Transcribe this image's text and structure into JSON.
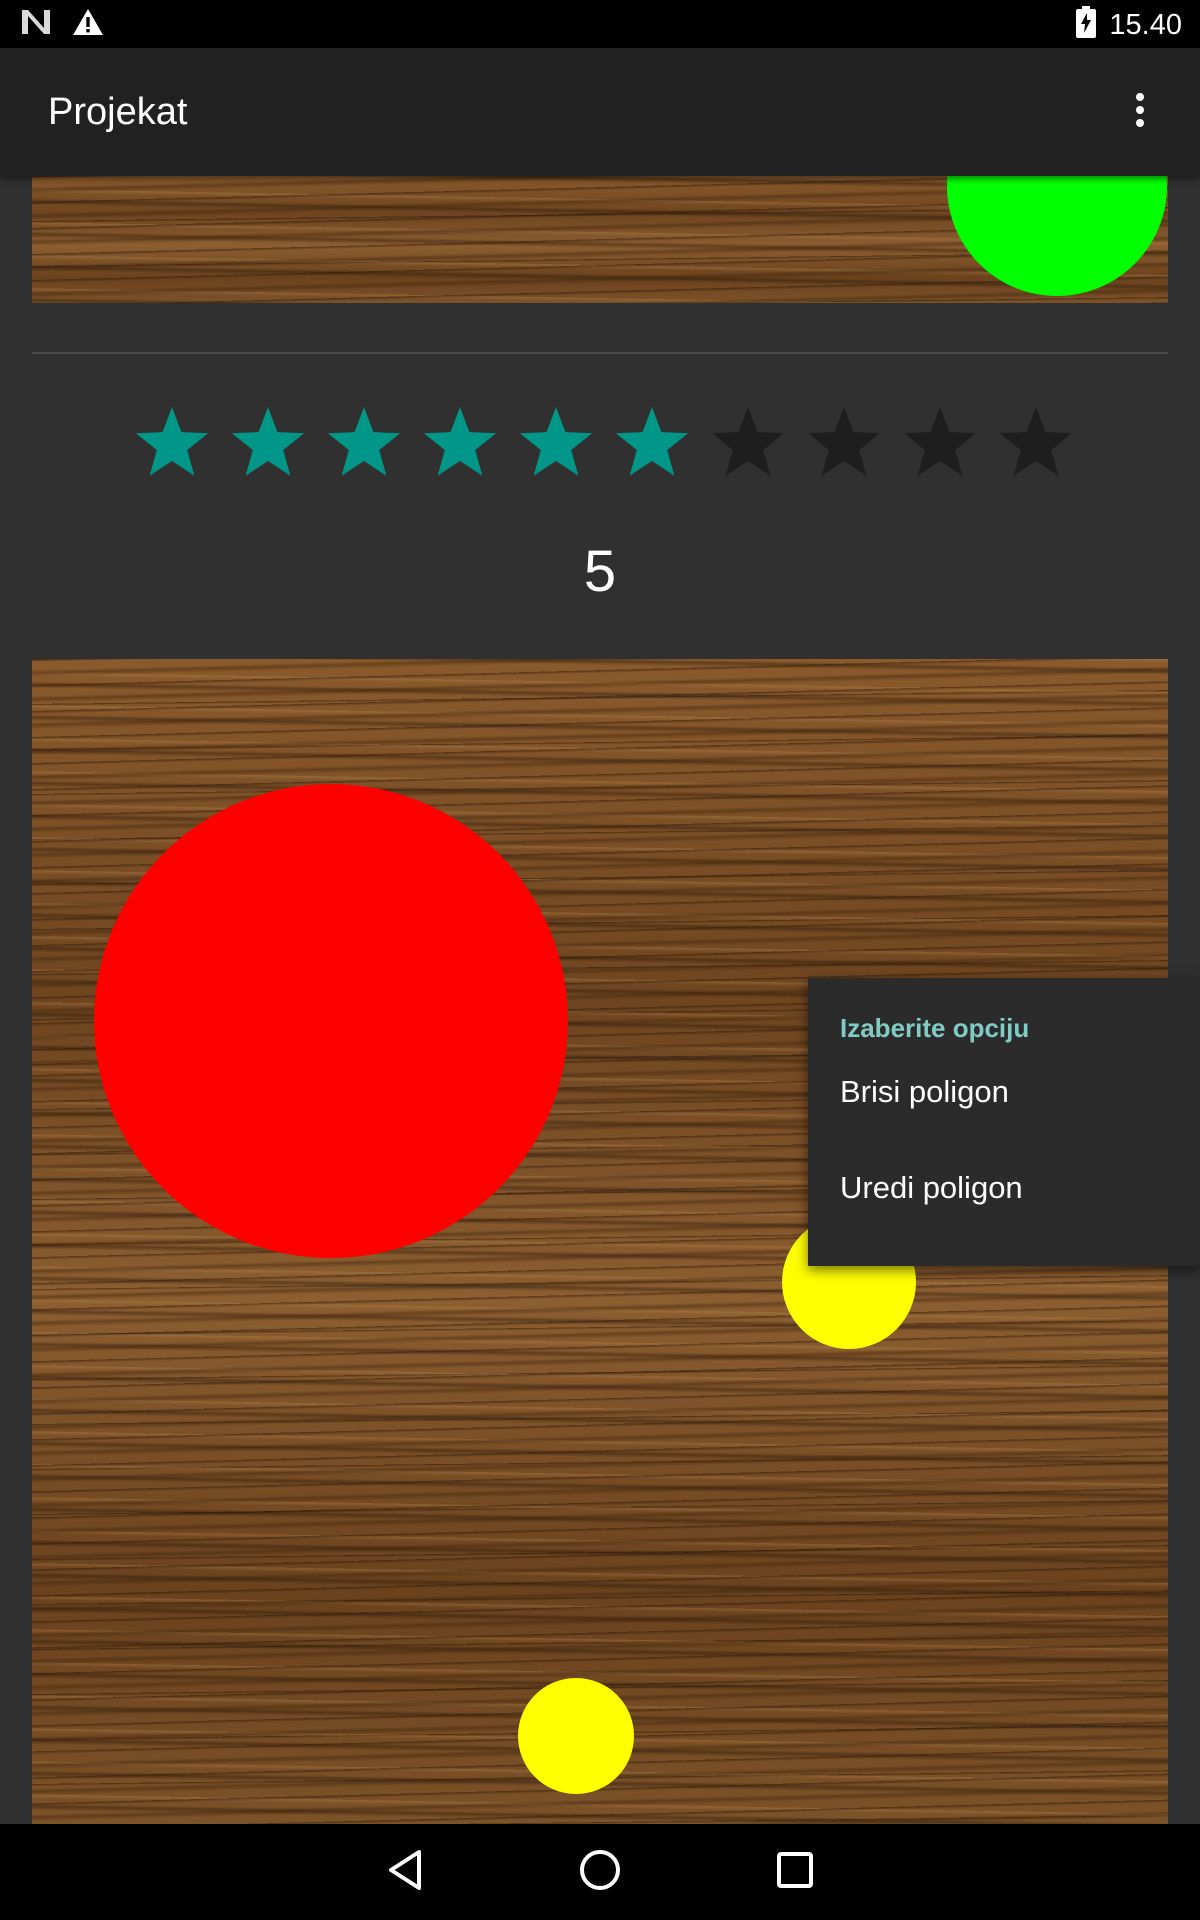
{
  "status_bar": {
    "time": "15.40",
    "icons": [
      "nfc-n-icon",
      "warning-icon",
      "battery-charging-icon"
    ]
  },
  "app_bar": {
    "title": "Projekat",
    "overflow_icon": "more-vert-icon"
  },
  "top_image": {
    "background": "wood-texture",
    "shapes": [
      {
        "name": "green-circle",
        "color": "#00ff00"
      }
    ]
  },
  "rating": {
    "stars_total": 10,
    "stars_filled": 6,
    "filled_color": "#009688",
    "empty_color": "#1e1e1e",
    "value": "5"
  },
  "main_image": {
    "background": "wood-texture",
    "shapes": [
      {
        "name": "red-circle",
        "color": "#ff0000"
      },
      {
        "name": "yellow-circle",
        "color": "#ffff00"
      },
      {
        "name": "yellow-circle",
        "color": "#ffff00"
      }
    ]
  },
  "context_menu": {
    "header": "Izaberite opciju",
    "items": [
      {
        "label": "Brisi poligon"
      },
      {
        "label": "Uredi poligon"
      }
    ]
  },
  "nav_bar": {
    "buttons": [
      "back-icon",
      "home-icon",
      "recents-icon"
    ]
  }
}
